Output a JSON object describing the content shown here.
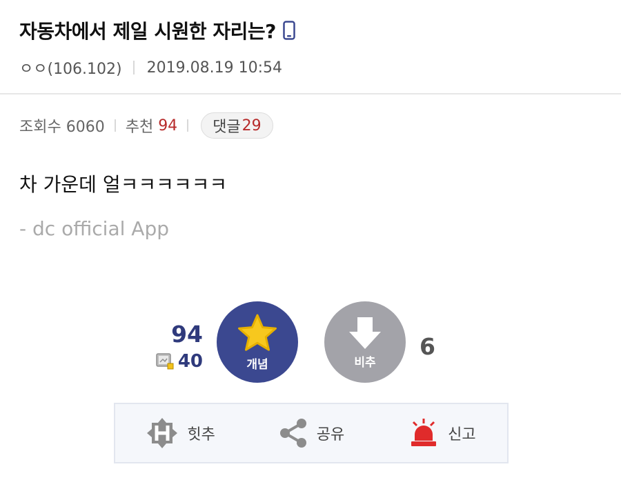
{
  "post": {
    "title": "자동차에서 제일 시원한 자리는?",
    "author": "ㅇㅇ(106.102)",
    "date": "2019.08.19 10:54"
  },
  "stats": {
    "views_label": "조회수 6060",
    "recommend_label": "추천",
    "recommend_count": "94",
    "comments_label": "댓글",
    "comments_count": "29"
  },
  "content": {
    "body": "차 가운데 얼ㅋㅋㅋㅋㅋㅋ",
    "signature": "- dc official App"
  },
  "vote": {
    "up_count": "94",
    "fixed_count": "40",
    "up_label": "개념",
    "down_label": "비추",
    "down_count": "6"
  },
  "actions": {
    "hit_label": "힛추",
    "share_label": "공유",
    "report_label": "신고"
  },
  "icons": {
    "mobile": "mobile-phone-icon",
    "star": "star-icon",
    "down_arrow": "down-arrow-icon",
    "fixed": "fixed-user-icon",
    "hit": "hit-badge-icon",
    "share": "share-icon",
    "report": "siren-icon"
  },
  "colors": {
    "accent_blue": "#3b4890",
    "down_gray": "#a3a3a9",
    "count_red": "#b72b2b",
    "star_yellow": "#f7c81e",
    "siren_red": "#e02b2b"
  }
}
